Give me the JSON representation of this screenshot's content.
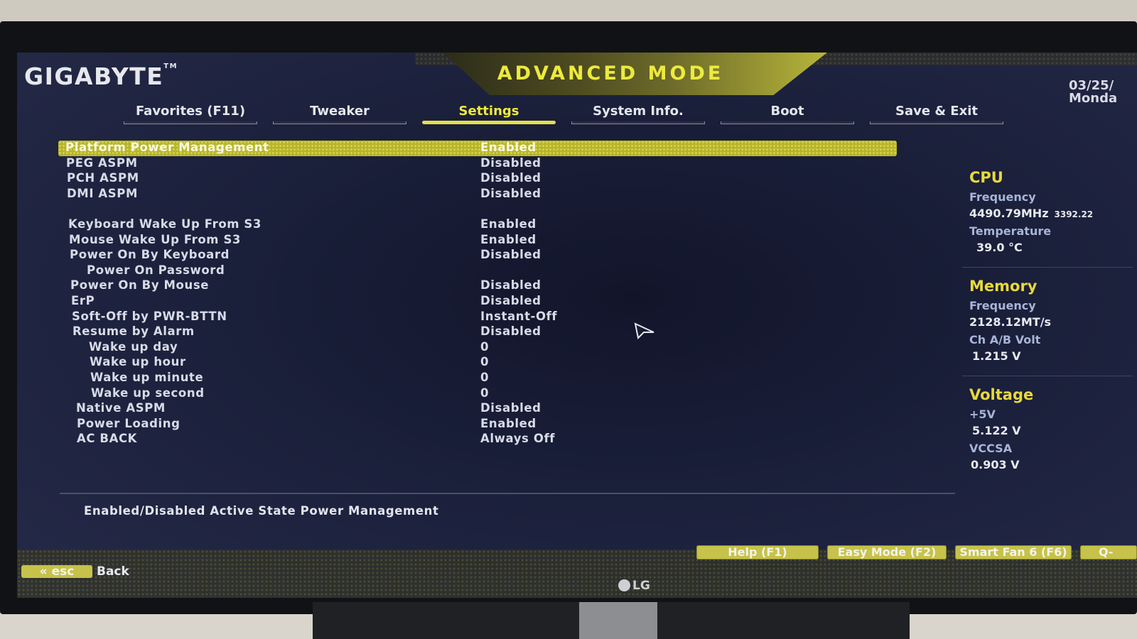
{
  "brand": {
    "logo": "GIGABYTE",
    "trademark": "TM",
    "mode_title": "ADVANCED MODE",
    "date_partial": "03/25/",
    "day_partial": "Monda"
  },
  "tabs": [
    {
      "label": "Favorites (F11)",
      "active": false
    },
    {
      "label": "Tweaker",
      "active": false
    },
    {
      "label": "Settings",
      "active": true
    },
    {
      "label": "System Info.",
      "active": false
    },
    {
      "label": "Boot",
      "active": false
    },
    {
      "label": "Save & Exit",
      "active": false
    }
  ],
  "settings": [
    {
      "label": "Platform Power Management",
      "value": "Enabled",
      "selected": true
    },
    {
      "label": "PEG ASPM",
      "value": "Disabled"
    },
    {
      "label": "PCH ASPM",
      "value": "Disabled"
    },
    {
      "label": "DMI ASPM",
      "value": "Disabled"
    },
    {
      "label": "",
      "value": ""
    },
    {
      "label": "Keyboard Wake Up From S3",
      "value": "Enabled"
    },
    {
      "label": "Mouse Wake Up From S3",
      "value": "Enabled"
    },
    {
      "label": "Power On By Keyboard",
      "value": "Disabled"
    },
    {
      "label": "Power On Password",
      "value": ""
    },
    {
      "label": "Power On By Mouse",
      "value": "Disabled"
    },
    {
      "label": "ErP",
      "value": "Disabled"
    },
    {
      "label": "Soft-Off by PWR-BTTN",
      "value": "Instant-Off"
    },
    {
      "label": "Resume by Alarm",
      "value": "Disabled"
    },
    {
      "label": "Wake up day",
      "value": "0"
    },
    {
      "label": "Wake up hour",
      "value": "0"
    },
    {
      "label": "Wake up minute",
      "value": "0"
    },
    {
      "label": "Wake up second",
      "value": "0"
    },
    {
      "label": "Native ASPM",
      "value": "Disabled"
    },
    {
      "label": "Power Loading",
      "value": "Enabled"
    },
    {
      "label": "AC BACK",
      "value": "Always Off"
    }
  ],
  "help_text": "Enabled/Disabled Active State Power Management",
  "sidebar": {
    "cpu": {
      "heading": "CPU",
      "freq_label": "Frequency",
      "freq_value": "4490.79MHz",
      "freq_sub": "3392.22",
      "temp_label": "Temperature",
      "temp_value": "39.0 °C"
    },
    "memory": {
      "heading": "Memory",
      "freq_label": "Frequency",
      "freq_value": "2128.12MT/s",
      "volt_label": "Ch A/B Volt",
      "volt_value": "1.215 V"
    },
    "voltage": {
      "heading": "Voltage",
      "v5_label": "+5V",
      "v5_value": "5.122 V",
      "vccsa_label": "VCCSA",
      "vccsa_value": "0.903 V"
    }
  },
  "footer": {
    "help": "Help (F1)",
    "easy": "Easy Mode (F2)",
    "smartfan": "Smart Fan 6 (F6)",
    "q_partial": "Q-",
    "esc": "esc",
    "back": "Back"
  },
  "monitor_brand": "LG",
  "colors": {
    "accent_yellow": "#e3e048",
    "screen_bg": "#1a1f3a",
    "text": "#d8dbe8"
  }
}
